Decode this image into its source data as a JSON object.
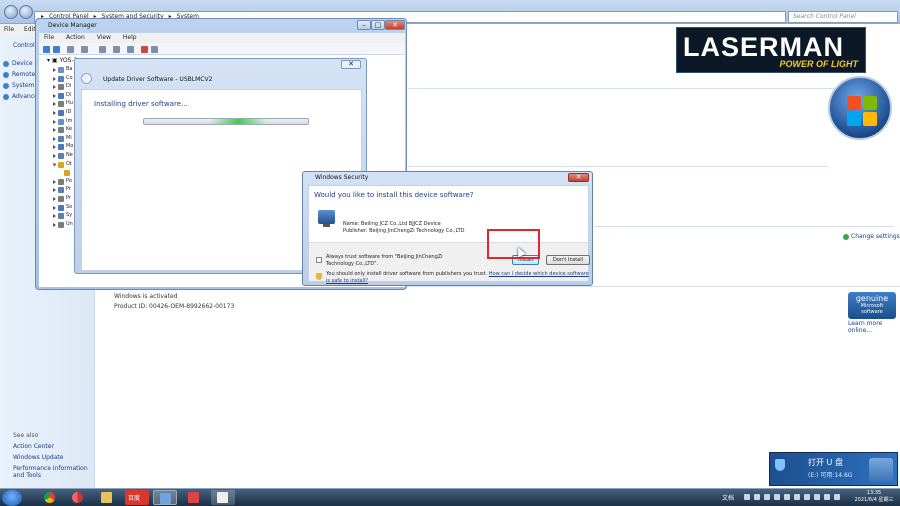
{
  "explorer": {
    "breadcrumb": [
      "Control Panel",
      "System and Security",
      "System"
    ],
    "search_placeholder": "Search Control Panel",
    "menu": [
      "File",
      "Edit"
    ]
  },
  "control_panel_left": {
    "heading": "Control",
    "items": [
      "Device M",
      "Remote",
      "System",
      "Advance"
    ],
    "see_also": "See also",
    "links": [
      "Action Center",
      "Windows Update",
      "Performance Information and Tools"
    ]
  },
  "system_info": {
    "activated": "Windows is activated",
    "product_id": "Product ID: 00426-OEM-8992662-00173",
    "change_settings": "Change settings",
    "genuine_line1": "genuine",
    "genuine_line2": "Microsoft",
    "genuine_line3": "software",
    "learn_more": "Learn more online..."
  },
  "logo": {
    "brand": "LASERMAN",
    "tagline": "POWER OF LIGHT"
  },
  "device_manager": {
    "title": "Device Manager",
    "menu": [
      "File",
      "Action",
      "View",
      "Help"
    ],
    "tree_root": "YOS-2",
    "tree_rows": [
      {
        "label": "Ba",
        "color": "#6a8fc4"
      },
      {
        "label": "Co",
        "color": "#5a7fb5"
      },
      {
        "label": "Di",
        "color": "#7c7c7c"
      },
      {
        "label": "Di",
        "color": "#4a78b8"
      },
      {
        "label": "Hu",
        "color": "#7c7c7c"
      },
      {
        "label": "ID",
        "color": "#4a78b8"
      },
      {
        "label": "Im",
        "color": "#6a8fc4"
      },
      {
        "label": "Ke",
        "color": "#7c7c7c"
      },
      {
        "label": "Mi",
        "color": "#5a7fb5"
      },
      {
        "label": "Mo",
        "color": "#4a78b8"
      },
      {
        "label": "Ne",
        "color": "#5a7fb5"
      },
      {
        "label": "Ot",
        "color": "#d9a521"
      },
      {
        "label": "",
        "color": "#d9a521"
      },
      {
        "label": "Po",
        "color": "#7c7c7c"
      },
      {
        "label": "Pr",
        "color": "#5a7fb5"
      },
      {
        "label": "Pr",
        "color": "#7c7c7c"
      },
      {
        "label": "So",
        "color": "#4a78b8"
      },
      {
        "label": "Sy",
        "color": "#5a7fb5"
      },
      {
        "label": "Un",
        "color": "#7c7c7c"
      }
    ]
  },
  "update_driver": {
    "title": "Update Driver Software - USBLMCV2",
    "heading": "Installing driver software...",
    "close_glyph": "✕",
    "progress": 0.6
  },
  "security_dialog": {
    "title": "Windows Security",
    "close_glyph": "✕",
    "question": "Would you like to install this device software?",
    "name": "Name: Beiling JCZ Co.,Ltd  BJJCZ Device",
    "publisher": "Publisher: Beijing JinChengZi Technology Co.,LTD",
    "trust_label": "Always trust software from \"Beijing JinChengZi Technology Co.,LTD\".",
    "install_label": "Install",
    "dont_install_label": "Don't Install",
    "warning": "You should only install driver software from publishers you trust.",
    "warning_link": "How can I decide which device software",
    "warning_link2": "is safe to install?"
  },
  "usb_popup": {
    "open": "打开 U 盘",
    "available": "(E:) 可用:14.6G"
  },
  "taskbar": {
    "lang": "文档",
    "time": "13:35",
    "date": "2021/6/4 星期三",
    "baidu_label": "百度"
  }
}
